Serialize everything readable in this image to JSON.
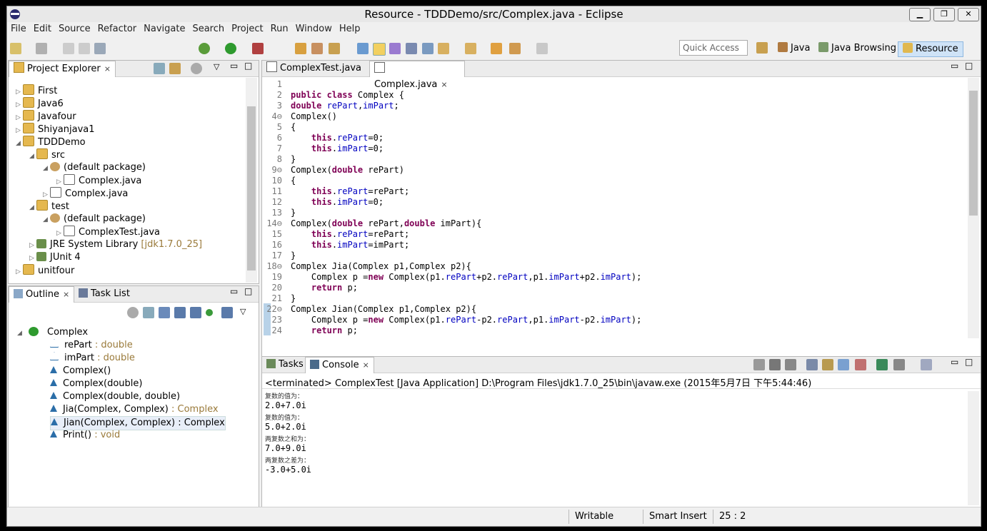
{
  "window": {
    "title": "Resource - TDDDemo/src/Complex.java - Eclipse"
  },
  "menu": [
    "File",
    "Edit",
    "Source",
    "Refactor",
    "Navigate",
    "Search",
    "Project",
    "Run",
    "Window",
    "Help"
  ],
  "toolbar": {
    "quick_access": "Quick Access"
  },
  "perspectives": [
    {
      "label": "Java"
    },
    {
      "label": "Java Browsing"
    },
    {
      "label": "Resource"
    }
  ],
  "project_explorer": {
    "tab_label": "Project Explorer",
    "items": [
      {
        "label": "First",
        "indent": 0,
        "twisty": "▷",
        "type": "folder"
      },
      {
        "label": "Java6",
        "indent": 0,
        "twisty": "▷",
        "type": "folder"
      },
      {
        "label": "Javafour",
        "indent": 0,
        "twisty": "▷",
        "type": "folder"
      },
      {
        "label": "Shiyanjava1",
        "indent": 0,
        "twisty": "▷",
        "type": "folder"
      },
      {
        "label": "TDDDemo",
        "indent": 0,
        "twisty": "◢",
        "type": "folder"
      },
      {
        "label": "src",
        "indent": 1,
        "twisty": "◢",
        "type": "folder"
      },
      {
        "label": "(default package)",
        "indent": 2,
        "twisty": "◢",
        "type": "pkg"
      },
      {
        "label": "Complex.java",
        "indent": 3,
        "twisty": "▷",
        "type": "java"
      },
      {
        "label": "Complex.java",
        "indent": 2,
        "twisty": "▷",
        "type": "java"
      },
      {
        "label": "test",
        "indent": 1,
        "twisty": "◢",
        "type": "folder"
      },
      {
        "label": "(default package)",
        "indent": 2,
        "twisty": "◢",
        "type": "pkg"
      },
      {
        "label": "ComplexTest.java",
        "indent": 3,
        "twisty": "▷",
        "type": "java"
      },
      {
        "label": "JRE System Library",
        "suffix": "[jdk1.7.0_25]",
        "indent": 1,
        "twisty": "▷",
        "type": "lib"
      },
      {
        "label": "JUnit 4",
        "indent": 1,
        "twisty": "▷",
        "type": "lib"
      },
      {
        "label": "unitfour",
        "indent": 0,
        "twisty": "▷",
        "type": "folder"
      }
    ]
  },
  "outline": {
    "tab_label": "Outline",
    "task_tab_label": "Task List",
    "root": "Complex",
    "items": [
      {
        "name": "rePart",
        "type": " : double",
        "kind": "field"
      },
      {
        "name": "imPart",
        "type": " : double",
        "kind": "field"
      },
      {
        "name": "Complex()",
        "type": "",
        "kind": "ctor"
      },
      {
        "name": "Complex(double)",
        "type": "",
        "kind": "ctor"
      },
      {
        "name": "Complex(double, double)",
        "type": "",
        "kind": "ctor"
      },
      {
        "name": "Jia(Complex, Complex)",
        "type": " : Complex",
        "kind": "method"
      },
      {
        "name": "Jian(Complex, Complex) : Complex",
        "type": "",
        "kind": "method"
      },
      {
        "name": "Print()",
        "type": " : void",
        "kind": "method"
      }
    ]
  },
  "editor": {
    "tabs": [
      "ComplexTest.java",
      "Complex.java"
    ],
    "lines": [
      {
        "n": "1",
        "segs": []
      },
      {
        "n": "2",
        "segs": [
          {
            "t": "public class ",
            "c": "kw"
          },
          {
            "t": "Complex {",
            "c": ""
          }
        ]
      },
      {
        "n": "3",
        "segs": [
          {
            "t": "double ",
            "c": "kw"
          },
          {
            "t": "rePart",
            "c": "fld"
          },
          {
            "t": ",",
            "c": ""
          },
          {
            "t": "imPart",
            "c": "fld"
          },
          {
            "t": ";",
            "c": ""
          }
        ]
      },
      {
        "n": "4⊖",
        "segs": [
          {
            "t": "Complex()",
            "c": ""
          }
        ]
      },
      {
        "n": "5",
        "segs": [
          {
            "t": "{",
            "c": ""
          }
        ]
      },
      {
        "n": "6",
        "segs": [
          {
            "t": "    ",
            "c": ""
          },
          {
            "t": "this",
            "c": "kw"
          },
          {
            "t": ".",
            "c": ""
          },
          {
            "t": "rePart",
            "c": "fld"
          },
          {
            "t": "=0;",
            "c": ""
          }
        ]
      },
      {
        "n": "7",
        "segs": [
          {
            "t": "    ",
            "c": ""
          },
          {
            "t": "this",
            "c": "kw"
          },
          {
            "t": ".",
            "c": ""
          },
          {
            "t": "imPart",
            "c": "fld"
          },
          {
            "t": "=0;",
            "c": ""
          }
        ]
      },
      {
        "n": "8",
        "segs": [
          {
            "t": "}",
            "c": ""
          }
        ]
      },
      {
        "n": "9⊖",
        "segs": [
          {
            "t": "Complex(",
            "c": ""
          },
          {
            "t": "double ",
            "c": "kw"
          },
          {
            "t": "rePart)",
            "c": ""
          }
        ]
      },
      {
        "n": "10",
        "segs": [
          {
            "t": "{",
            "c": ""
          }
        ]
      },
      {
        "n": "11",
        "segs": [
          {
            "t": "    ",
            "c": ""
          },
          {
            "t": "this",
            "c": "kw"
          },
          {
            "t": ".",
            "c": ""
          },
          {
            "t": "rePart",
            "c": "fld"
          },
          {
            "t": "=rePart;",
            "c": ""
          }
        ]
      },
      {
        "n": "12",
        "segs": [
          {
            "t": "    ",
            "c": ""
          },
          {
            "t": "this",
            "c": "kw"
          },
          {
            "t": ".",
            "c": ""
          },
          {
            "t": "imPart",
            "c": "fld"
          },
          {
            "t": "=0;",
            "c": ""
          }
        ]
      },
      {
        "n": "13",
        "segs": [
          {
            "t": "}",
            "c": ""
          }
        ]
      },
      {
        "n": "14⊖",
        "segs": [
          {
            "t": "Complex(",
            "c": ""
          },
          {
            "t": "double ",
            "c": "kw"
          },
          {
            "t": "rePart,",
            "c": ""
          },
          {
            "t": "double ",
            "c": "kw"
          },
          {
            "t": "imPart){",
            "c": ""
          }
        ]
      },
      {
        "n": "15",
        "segs": [
          {
            "t": "    ",
            "c": ""
          },
          {
            "t": "this",
            "c": "kw"
          },
          {
            "t": ".",
            "c": ""
          },
          {
            "t": "rePart",
            "c": "fld"
          },
          {
            "t": "=rePart;",
            "c": ""
          }
        ]
      },
      {
        "n": "16",
        "segs": [
          {
            "t": "    ",
            "c": ""
          },
          {
            "t": "this",
            "c": "kw"
          },
          {
            "t": ".",
            "c": ""
          },
          {
            "t": "imPart",
            "c": "fld"
          },
          {
            "t": "=imPart;",
            "c": ""
          }
        ]
      },
      {
        "n": "17",
        "segs": [
          {
            "t": "}",
            "c": ""
          }
        ]
      },
      {
        "n": "18⊖",
        "segs": [
          {
            "t": "Complex Jia(Complex p1,Complex p2){",
            "c": ""
          }
        ]
      },
      {
        "n": "19",
        "segs": [
          {
            "t": "    Complex p =",
            "c": ""
          },
          {
            "t": "new ",
            "c": "kw"
          },
          {
            "t": "Complex(p1.",
            "c": ""
          },
          {
            "t": "rePart",
            "c": "fld"
          },
          {
            "t": "+p2.",
            "c": ""
          },
          {
            "t": "rePart",
            "c": "fld"
          },
          {
            "t": ",p1.",
            "c": ""
          },
          {
            "t": "imPart",
            "c": "fld"
          },
          {
            "t": "+p2.",
            "c": ""
          },
          {
            "t": "imPart",
            "c": "fld"
          },
          {
            "t": ");",
            "c": ""
          }
        ]
      },
      {
        "n": "20",
        "segs": [
          {
            "t": "    ",
            "c": ""
          },
          {
            "t": "return ",
            "c": "kw"
          },
          {
            "t": "p;",
            "c": ""
          }
        ]
      },
      {
        "n": "21",
        "segs": [
          {
            "t": "}",
            "c": ""
          }
        ]
      },
      {
        "n": "22⊖",
        "segs": [
          {
            "t": "Complex Jian(Complex p1,Complex p2){",
            "c": ""
          }
        ]
      },
      {
        "n": "23",
        "segs": [
          {
            "t": "    Complex p =",
            "c": ""
          },
          {
            "t": "new ",
            "c": "kw"
          },
          {
            "t": "Complex(p1.",
            "c": ""
          },
          {
            "t": "rePart",
            "c": "fld"
          },
          {
            "t": "-p2.",
            "c": ""
          },
          {
            "t": "rePart",
            "c": "fld"
          },
          {
            "t": ",p1.",
            "c": ""
          },
          {
            "t": "imPart",
            "c": "fld"
          },
          {
            "t": "-p2.",
            "c": ""
          },
          {
            "t": "imPart",
            "c": "fld"
          },
          {
            "t": ");",
            "c": ""
          }
        ]
      },
      {
        "n": "24",
        "segs": [
          {
            "t": "    ",
            "c": ""
          },
          {
            "t": "return ",
            "c": "kw"
          },
          {
            "t": "p;",
            "c": ""
          }
        ]
      }
    ]
  },
  "console": {
    "tasks_tab": "Tasks",
    "tab_label": "Console",
    "header": "<terminated> ComplexTest [Java Application] D:\\Program Files\\jdk1.7.0_25\\bin\\javaw.exe (2015年5月7日 下午5:44:46)",
    "lines": [
      {
        "t": "复数的值为：",
        "small": true
      },
      {
        "t": "2.0+7.0i",
        "small": false
      },
      {
        "t": "复数的值为：",
        "small": true
      },
      {
        "t": "5.0+2.0i",
        "small": false
      },
      {
        "t": "两复数之和为：",
        "small": true
      },
      {
        "t": "7.0+9.0i",
        "small": false
      },
      {
        "t": "两复数之差为：",
        "small": true
      },
      {
        "t": "-3.0+5.0i",
        "small": false
      }
    ]
  },
  "status": {
    "writable": "Writable",
    "insert_mode": "Smart Insert",
    "position": "25 : 2"
  },
  "colors": {
    "keyword": "#7f0055",
    "field": "#0000c0",
    "accent": "#3399ff"
  }
}
